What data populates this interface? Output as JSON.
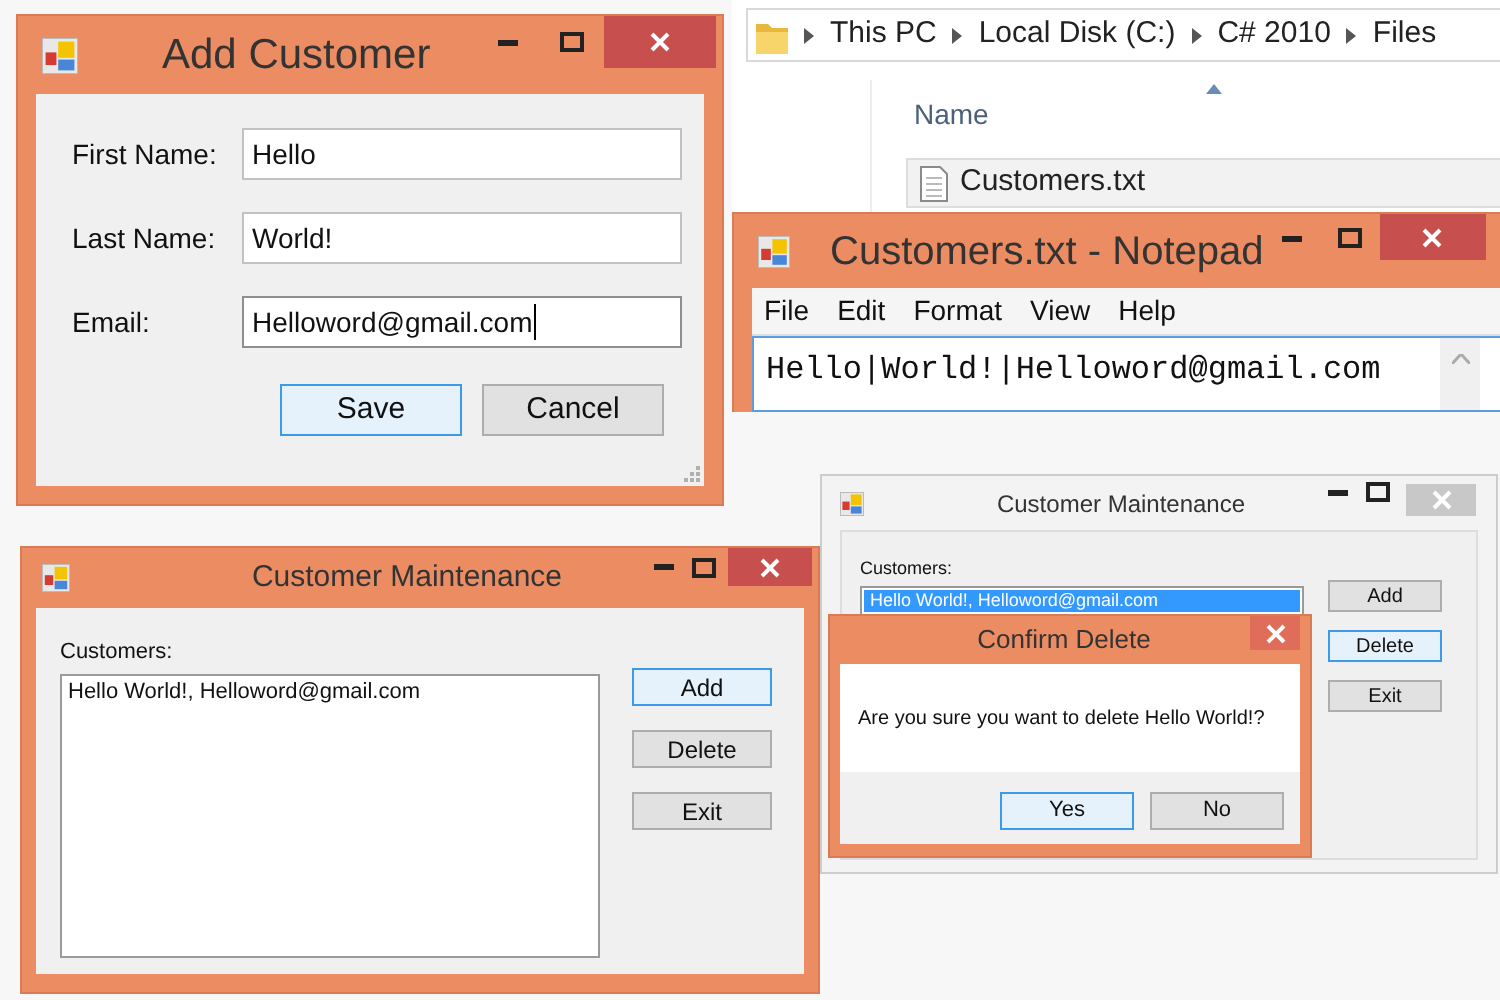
{
  "add_customer": {
    "title": "Add Customer",
    "active": true,
    "fields": [
      {
        "label": "First Name:",
        "value": "Hello",
        "focused": false
      },
      {
        "label": "Last Name:",
        "value": "World!",
        "focused": false
      },
      {
        "label": "Email:",
        "value": "Helloword@gmail.com",
        "focused": true
      }
    ],
    "buttons": [
      {
        "label": "Save",
        "focused": true
      },
      {
        "label": "Cancel",
        "focused": false
      }
    ]
  },
  "explorer": {
    "path": [
      "This PC",
      "Local Disk (C:)",
      "C# 2010",
      "Files"
    ],
    "column": "Name",
    "files": [
      {
        "name": "Customers.txt",
        "selected": true
      }
    ]
  },
  "notepad": {
    "title": "Customers.txt - Notepad",
    "active": true,
    "menu": [
      "File",
      "Edit",
      "Format",
      "View",
      "Help"
    ],
    "text": "Hello|World!|Helloword@gmail.com"
  },
  "customer_maintenance": {
    "title": "Customer Maintenance",
    "active": true,
    "list_label": "Customers:",
    "items": [
      {
        "text": "Hello World!, Helloword@gmail.com",
        "selected": false
      }
    ],
    "buttons": [
      {
        "label": "Add",
        "focused": true
      },
      {
        "label": "Delete",
        "focused": false
      },
      {
        "label": "Exit",
        "focused": false
      }
    ]
  },
  "customer_maintenance_behind": {
    "title": "Customer Maintenance",
    "active": false,
    "list_label": "Customers:",
    "items": [
      {
        "text": "Hello World!, Helloword@gmail.com",
        "selected": true
      }
    ],
    "buttons": [
      {
        "label": "Add",
        "focused": false
      },
      {
        "label": "Delete",
        "focused": true
      },
      {
        "label": "Exit",
        "focused": false
      }
    ]
  },
  "confirm_delete": {
    "title": "Confirm Delete",
    "active": true,
    "message": "Are you sure you want to delete Hello World!?",
    "buttons": [
      {
        "label": "Yes",
        "focused": true
      },
      {
        "label": "No",
        "focused": false
      }
    ]
  }
}
